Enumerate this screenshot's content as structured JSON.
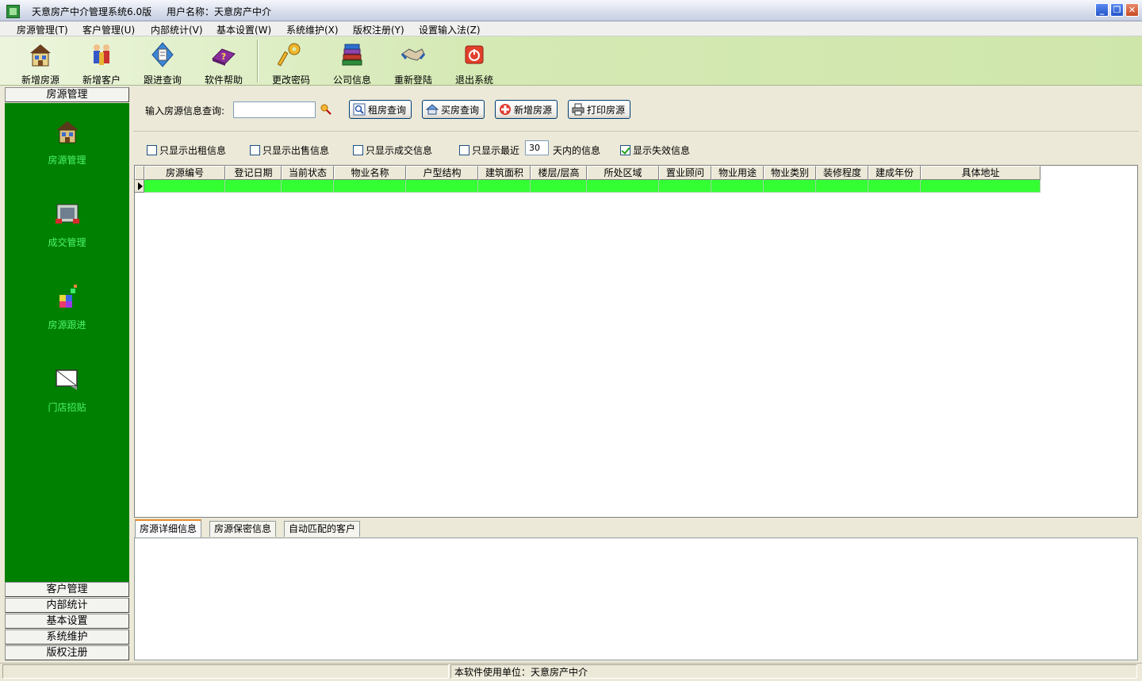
{
  "window": {
    "title": "天意房产中介管理系统6.0版",
    "user_label": "用户名称：天意房产中介",
    "controls": [
      "minimize",
      "restore",
      "close"
    ]
  },
  "menu": [
    {
      "label": "房源管理(T)"
    },
    {
      "label": "客户管理(U)"
    },
    {
      "label": "内部统计(V)"
    },
    {
      "label": "基本设置(W)"
    },
    {
      "label": "系统维护(X)"
    },
    {
      "label": "版权注册(Y)"
    },
    {
      "label": "设置输入法(Z)"
    }
  ],
  "toolbar": [
    {
      "label": "新增房源",
      "icon": "house-icon"
    },
    {
      "label": "新增客户",
      "icon": "customers-icon"
    },
    {
      "label": "跟进查询",
      "icon": "followup-icon"
    },
    {
      "label": "软件帮助",
      "icon": "help-book-icon"
    },
    {
      "label": "更改密码",
      "icon": "key-icon"
    },
    {
      "label": "公司信息",
      "icon": "books-icon"
    },
    {
      "label": "重新登陆",
      "icon": "handshake-icon"
    },
    {
      "label": "退出系统",
      "icon": "power-icon"
    }
  ],
  "sidebar": {
    "active_section": "房源管理",
    "tools": [
      {
        "label": "房源管理",
        "icon": "house-icon"
      },
      {
        "label": "成交管理",
        "icon": "deal-icon"
      },
      {
        "label": "房源跟进",
        "icon": "cubes-icon"
      },
      {
        "label": "门店招贴",
        "icon": "poster-icon"
      }
    ],
    "sections": [
      {
        "label": "客户管理"
      },
      {
        "label": "内部统计"
      },
      {
        "label": "基本设置"
      },
      {
        "label": "系统维护"
      },
      {
        "label": "版权注册"
      }
    ]
  },
  "search": {
    "label": "输入房源信息查询:",
    "value": "",
    "buttons": [
      {
        "label": "租房查询",
        "icon": "magnifier-icon"
      },
      {
        "label": "买房查询",
        "icon": "house-search-icon"
      },
      {
        "label": "新增房源",
        "icon": "plus-icon"
      },
      {
        "label": "打印房源",
        "icon": "printer-icon"
      }
    ]
  },
  "filters": {
    "rent_only": {
      "label": "只显示出租信息",
      "checked": false
    },
    "sale_only": {
      "label": "只显示出售信息",
      "checked": false
    },
    "deal_only": {
      "label": "只显示成交信息",
      "checked": false
    },
    "recent_only": {
      "label": "只显示最近",
      "checked": false
    },
    "recent_days": "30",
    "recent_suffix": "天内的信息",
    "show_invalid": {
      "label": "显示失效信息",
      "checked": true
    }
  },
  "grid": {
    "columns": [
      "房源编号",
      "登记日期",
      "当前状态",
      "物业名称",
      "户型结构",
      "建筑面积",
      "楼层/层高",
      "所处区域",
      "置业顾问",
      "物业用途",
      "物业类别",
      "装修程度",
      "建成年份",
      "具体地址"
    ],
    "rows": [
      [
        "",
        "",
        "",
        "",
        "",
        "",
        "",
        "",
        "",
        "",
        "",
        "",
        "",
        ""
      ]
    ],
    "row_color": "#33ff33"
  },
  "detail_tabs": [
    {
      "label": "房源详细信息",
      "active": true
    },
    {
      "label": "房源保密信息",
      "active": false
    },
    {
      "label": "自动匹配的客户",
      "active": false
    }
  ],
  "status": {
    "text": "本软件使用单位：天意房产中介"
  },
  "colors": {
    "sidebar_green": "#008000",
    "sidebar_label": "#4cf66f",
    "toolbar_bg": "#d5e9b5"
  }
}
